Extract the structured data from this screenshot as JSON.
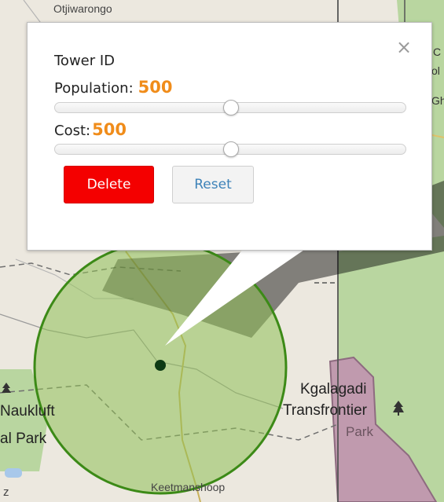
{
  "map": {
    "labels": [
      "Otjiwarongo",
      "Kgalagadi",
      "Transfrontier",
      "Park",
      "Naukluft",
      "al Park",
      "Keetmanshoop",
      "z"
    ],
    "edge_letters": [
      "C",
      "ol",
      "Gh"
    ],
    "colors": {
      "coverage_fill": "#8fbf55",
      "coverage_stroke": "#3c8a17",
      "tower_dot": "#0d3a14",
      "park_green": "#b9d6a0",
      "park_purple": "#c09aae"
    }
  },
  "popup": {
    "close_glyph": "×",
    "title": "Tower ID",
    "population_label": "Population:",
    "population_value": "500",
    "population_slider": 0.5,
    "cost_label": "Cost:",
    "cost_value": "500",
    "cost_slider": 0.5,
    "delete_label": "Delete",
    "reset_label": "Reset",
    "colors": {
      "value": "#f08c1a",
      "delete_bg": "#f40000",
      "reset_text": "#3d82b8"
    }
  }
}
